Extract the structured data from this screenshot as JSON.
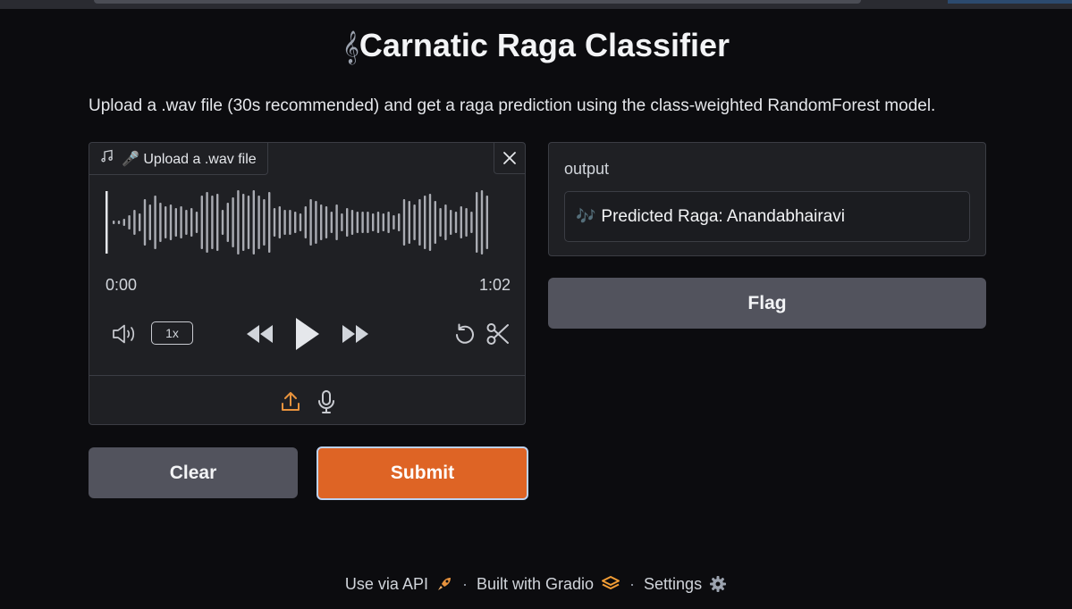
{
  "app": {
    "title": "Carnatic Raga Classifier",
    "title_icon": "musical-score-emoji",
    "description": "Upload a .wav file (30s recommended) and get a raga prediction using the class-weighted RandomForest model."
  },
  "audio_input": {
    "label": "🎤 Upload a .wav file",
    "label_icon": "music-note-icon",
    "current_time": "0:00",
    "duration": "1:02",
    "playback_speed": "1x",
    "icons": [
      "volume-icon",
      "rewind-icon",
      "play-icon",
      "fast-forward-icon",
      "undo-icon",
      "scissors-icon",
      "upload-icon",
      "microphone-icon",
      "close-icon"
    ]
  },
  "buttons": {
    "clear": "Clear",
    "submit": "Submit",
    "flag": "Flag"
  },
  "output": {
    "label": "output",
    "value": "Predicted Raga: Anandabhairavi",
    "value_icon": "musical-notes-emoji"
  },
  "footer": {
    "api": "Use via API",
    "built": "Built with Gradio",
    "settings": "Settings"
  },
  "colors": {
    "background": "#0c0c0f",
    "panel": "#1f2024",
    "primary": "#de6425",
    "secondary_button": "#52535d",
    "accent_icon": "#e8933d"
  }
}
